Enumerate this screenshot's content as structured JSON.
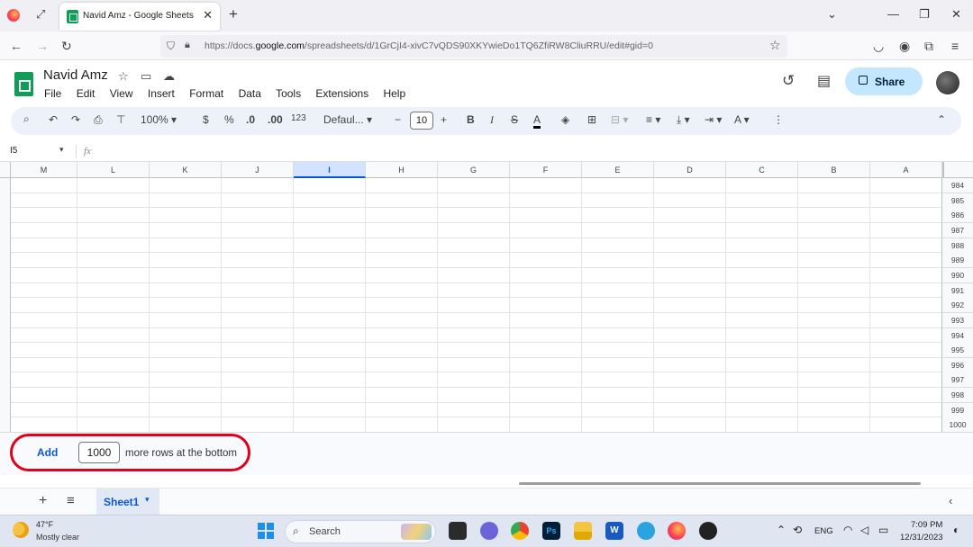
{
  "browser": {
    "tab_title": "Navid Amz - Google Sheets",
    "tab_close": "✕",
    "new_tab": "+",
    "url_prefix": "https://docs.",
    "url_host": "google.com",
    "url_path": "/spreadsheets/d/1GrCjI4-xivC7vQDS90XKYwieDo1TQ6ZfiRW8CliuRRU/edit#gid=0"
  },
  "doc": {
    "title": "Navid Amz",
    "menu": [
      "File",
      "Edit",
      "View",
      "Insert",
      "Format",
      "Data",
      "Tools",
      "Extensions",
      "Help"
    ],
    "share_label": "Share"
  },
  "toolbar": {
    "zoom": "100%",
    "currency": "$",
    "percent": "%",
    "dec_decrease": ".0",
    "dec_increase": ".00",
    "number_format": "123",
    "font": "Defaul...",
    "font_size": "10",
    "bold": "B",
    "italic": "I"
  },
  "formula_bar": {
    "cell_ref": "I5",
    "fx": "fx"
  },
  "grid": {
    "columns": [
      "M",
      "L",
      "K",
      "J",
      "I",
      "H",
      "G",
      "F",
      "E",
      "D",
      "C",
      "B",
      "A"
    ],
    "selected_column": "I",
    "rows": [
      "984",
      "985",
      "986",
      "987",
      "988",
      "989",
      "990",
      "991",
      "992",
      "993",
      "994",
      "995",
      "996",
      "997",
      "998",
      "999",
      "1000"
    ]
  },
  "add_rows": {
    "button": "Add",
    "value": "1000",
    "suffix": "more rows at the bottom"
  },
  "sheets": {
    "add": "+",
    "list": "≡",
    "active": "Sheet1"
  },
  "taskbar": {
    "weather_temp": "47°F",
    "weather_desc": "Mostly clear",
    "search": "Search",
    "lang": "ENG",
    "time": "7:09 PM",
    "date": "12/31/2023"
  }
}
